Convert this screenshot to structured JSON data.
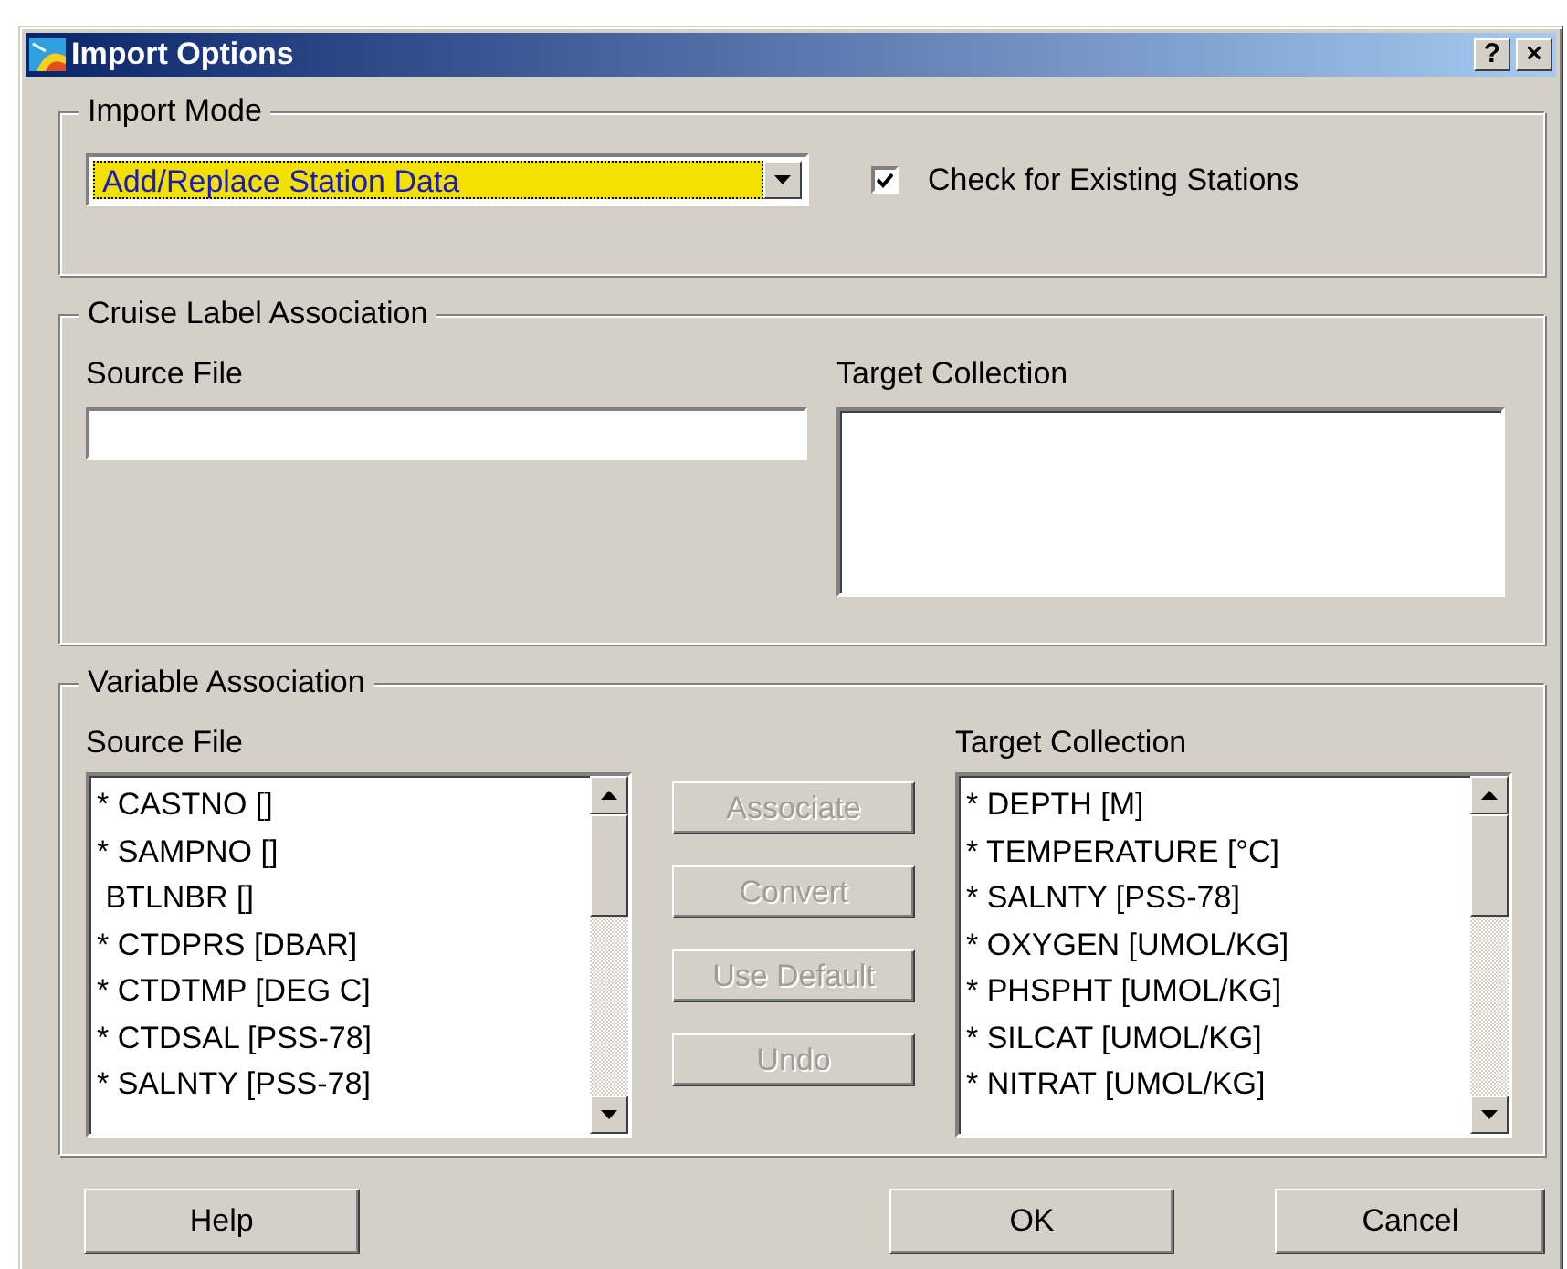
{
  "window": {
    "title": "Import Options",
    "help_button": "?",
    "close_button": "×"
  },
  "import_mode": {
    "legend": "Import Mode",
    "combo": {
      "value": "Add/Replace Station Data"
    },
    "checkbox": {
      "label": "Check for Existing Stations",
      "checked": true
    }
  },
  "cruise_label_association": {
    "legend": "Cruise Label Association",
    "source_label": "Source File",
    "target_label": "Target Collection"
  },
  "variable_association": {
    "legend": "Variable Association",
    "source_label": "Source File",
    "source_items": [
      {
        "label": "* CASTNO []",
        "selected": false
      },
      {
        "label": "* SAMPNO []",
        "selected": false
      },
      {
        "label": " BTLNBR []",
        "selected": false
      },
      {
        "label": "* CTDPRS [DBAR]",
        "selected": false
      },
      {
        "label": "* CTDTMP [DEG C]",
        "selected": false
      },
      {
        "label": "* CTDSAL [PSS-78]",
        "selected": false
      },
      {
        "label": "* SALNTY [PSS-78]",
        "selected": false
      }
    ],
    "actions": [
      {
        "label": "Associate",
        "disabled": true
      },
      {
        "label": "Convert",
        "disabled": true
      },
      {
        "label": "Use Default",
        "disabled": true
      },
      {
        "label": "Undo",
        "disabled": true
      }
    ],
    "target_label": "Target Collection",
    "target_items": [
      {
        "label": "* DEPTH [M]",
        "selected": false
      },
      {
        "label": "* TEMPERATURE [°C]",
        "selected": false
      },
      {
        "label": "* SALNTY [PSS-78]",
        "selected": false
      },
      {
        "label": "* OXYGEN [UMOL/KG]",
        "selected": false
      },
      {
        "label": "* PHSPHT [UMOL/KG]",
        "selected": false
      },
      {
        "label": "* SILCAT [UMOL/KG]",
        "selected": false
      },
      {
        "label": "* NITRAT [UMOL/KG]",
        "selected": false
      }
    ]
  },
  "buttons": [
    {
      "label": "Help"
    },
    {
      "label": "OK"
    },
    {
      "label": "Cancel"
    }
  ]
}
